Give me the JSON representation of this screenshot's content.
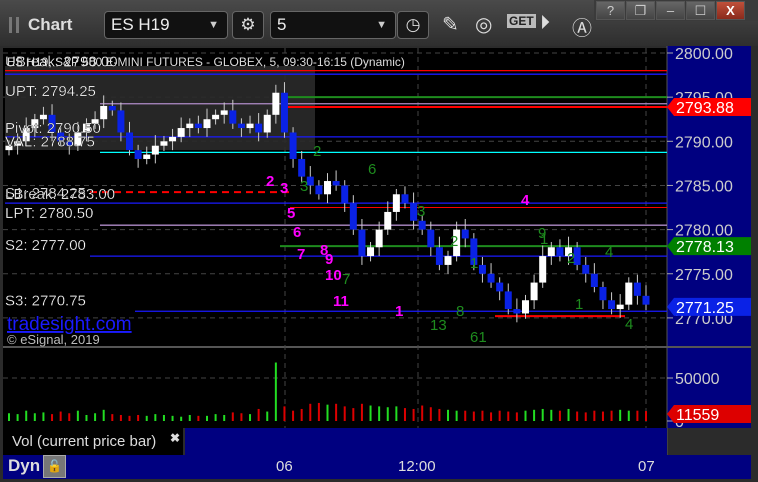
{
  "window": {
    "title": "Chart",
    "symbol": "ES H19",
    "interval": "5",
    "buttons": {
      "help": "?",
      "restore": "❐",
      "minimize": "–",
      "maximize": "☐",
      "close": "X"
    }
  },
  "toolbar_icons": [
    "gear-icon",
    "clock-icon",
    "pencil-icon",
    "study-icon",
    "get-icon",
    "play-icon",
    "a-icon"
  ],
  "toolbar_get_label": "GET",
  "chart_header": "ES H19, S&P 500 E-MINI FUTURES - GLOBEX, 5, 09:30-16:15 (Dynamic)",
  "watermark": {
    "site": "tradesight.com",
    "copyright": "© eSignal, 2019"
  },
  "colors": {
    "up": "#ffffff",
    "down": "#0a22e6",
    "axis_bg": "#000080",
    "vol_up": "#22dd22",
    "vol_down": "#dd0000",
    "count_magenta": "#ff00ff",
    "count_green": "#1e8c1e"
  },
  "chart_data": [
    {
      "type": "candlestick",
      "title": "",
      "ylim": [
        2767.5,
        2800.5
      ],
      "y_ticks": [
        "2800.00",
        "2795.00",
        "2790.00",
        "2785.00",
        "2780.00",
        "2775.00",
        "2770.00"
      ],
      "x_ticks": [
        "06",
        "12:00",
        "07"
      ],
      "grid": true,
      "closes": [
        2789.5,
        2790,
        2791.5,
        2792.5,
        2793,
        2791,
        2790,
        2789.5,
        2791,
        2792,
        2792.5,
        2794,
        2793.5,
        2791,
        2789,
        2788,
        2788.5,
        2789.5,
        2790,
        2790.5,
        2791.5,
        2792,
        2791.5,
        2792.5,
        2793,
        2793.5,
        2792,
        2791.5,
        2792,
        2791,
        2793,
        2795.5,
        2791,
        2788,
        2786,
        2785,
        2784,
        2785.5,
        2785,
        2783,
        2780,
        2777,
        2778,
        2780,
        2782,
        2784,
        2783,
        2781,
        2780,
        2778,
        2776,
        2777,
        2780,
        2779,
        2776,
        2775,
        2774,
        2773,
        2771,
        2770.5,
        2772,
        2774,
        2777,
        2778,
        2777,
        2778,
        2776,
        2775,
        2773.5,
        2772,
        2771,
        2771.5,
        2774,
        2772.5,
        2771.5
      ],
      "levels": [
        {
          "label": "UBreak: 2798.00",
          "price": 2798.0,
          "color": "#ff0000",
          "style": "solid"
        },
        {
          "label": "UPT: 2794.25",
          "price": 2794.25,
          "color": "#b08cc8",
          "style": "solid"
        },
        {
          "label": "Pivot: 2790.50",
          "price": 2790.5,
          "color": "#1a1aff",
          "style": "solid"
        },
        {
          "label": "VAL: 2788.75",
          "price": 2788.75,
          "color": "#00ffff",
          "style": "solid"
        },
        {
          "label": "S1: 2784.25",
          "price": 2784.25,
          "color": "#ff0000",
          "style": "dashed"
        },
        {
          "label": "LBreak: 2783.00",
          "price": 2783.0,
          "color": "#1a1aff",
          "style": "solid"
        },
        {
          "label": "LPT: 2780.50",
          "price": 2780.5,
          "color": "#b08cc8",
          "style": "solid"
        },
        {
          "label": "S2: 2777.00",
          "price": 2777.0,
          "color": "#1a1aff",
          "style": "solid"
        },
        {
          "label": "S3: 2770.75",
          "price": 2770.75,
          "color": "#1a1aff",
          "style": "solid"
        }
      ],
      "price_markers": [
        {
          "label": "2793.88",
          "price": 2793.88,
          "color": "#ff0000"
        },
        {
          "label": "2778.13",
          "price": 2778.13,
          "color": "#008000"
        },
        {
          "label": "2771.25",
          "price": 2771.25,
          "color": "#0a22e6"
        }
      ],
      "annotations": {
        "magenta": [
          "2",
          "3",
          "5",
          "6",
          "7",
          "8",
          "9",
          "10",
          "11",
          "4",
          "1"
        ],
        "green": [
          "2",
          "6",
          "3",
          "3",
          "2",
          "1",
          "1",
          "4",
          "2",
          "1",
          "7",
          "8",
          "13",
          "61",
          "4",
          "9"
        ]
      }
    },
    {
      "type": "bar",
      "title": "Vol (current price bar)",
      "ylim": [
        0,
        80000
      ],
      "y_ticks": [
        "50000",
        "0"
      ],
      "values": [
        9000,
        8000,
        12000,
        9000,
        10000,
        8000,
        11000,
        9000,
        12000,
        7000,
        9000,
        13000,
        8000,
        7000,
        6000,
        7000,
        6000,
        8000,
        7000,
        6000,
        5000,
        7000,
        6000,
        6000,
        8000,
        7000,
        10000,
        9000,
        8000,
        14000,
        11000,
        68000,
        17000,
        12000,
        14000,
        20000,
        21000,
        19000,
        20000,
        17000,
        15000,
        20000,
        18000,
        17000,
        16000,
        17000,
        15000,
        14000,
        18000,
        16000,
        14000,
        13000,
        12000,
        12000,
        11000,
        12000,
        10000,
        12000,
        11000,
        10000,
        12000,
        13000,
        14000,
        13000,
        12000,
        14000,
        11000,
        10000,
        12000,
        11000,
        12000,
        13000,
        12000,
        12000,
        11559
      ],
      "current_value_label": "11559",
      "y_marker_labels": [
        "50000",
        "0"
      ]
    }
  ],
  "footer": {
    "mode": "Dyn",
    "lock_icon": "lock-clock-icon"
  }
}
